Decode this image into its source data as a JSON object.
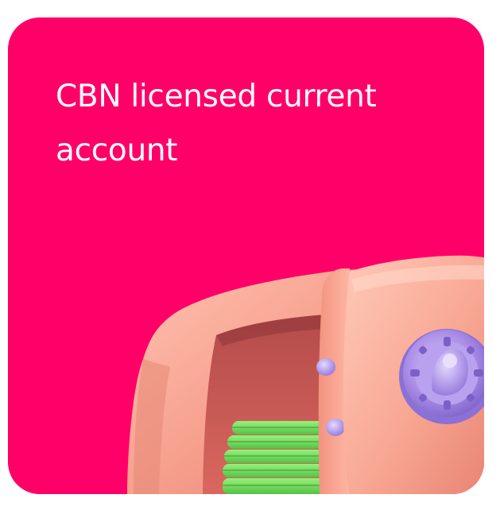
{
  "card": {
    "title": "CBN licensed current account",
    "background_color": "#FF0068",
    "text_color": "#FFFFFF"
  },
  "illustration": {
    "icon": "safe-with-cash-icon",
    "body_color": "#F7A08E",
    "dial_color": "#A98BE6",
    "cash_color": "#7ED957"
  }
}
